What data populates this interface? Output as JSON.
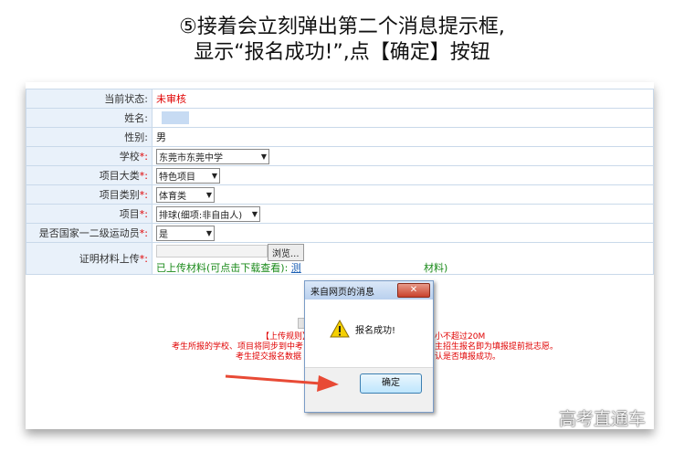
{
  "caption": {
    "line1": "⑤接着会立刻弹出第二个消息提示框,",
    "line2": "显示“报名成功!”,点【确定】按钮"
  },
  "form": {
    "rows": [
      {
        "label": "当前状态:",
        "value": "未审核"
      },
      {
        "label": "姓名:",
        "value": ""
      },
      {
        "label": "性别:",
        "value": "男"
      },
      {
        "label": "学校",
        "value": "东莞市东莞中学"
      },
      {
        "label": "项目大类",
        "value": "特色项目"
      },
      {
        "label": "项目类别",
        "value": "体育类"
      },
      {
        "label": "项目",
        "value": "排球(细项:非自由人)"
      },
      {
        "label": "是否国家一二级运动员",
        "value": "是"
      },
      {
        "label": "证明材料上传",
        "browse": "浏览...",
        "uploaded": "已上传材料(可点击下载查看):",
        "link_partial": "测",
        "tail_partial": "材料)"
      }
    ],
    "required_mark": "*:"
  },
  "rules": {
    "title_partial": "【上传规则】",
    "line1_partial": "考生所报的学校、项目将同步到中考",
    "line1_right": "主招生报名即为填报提前批志愿。",
    "line2_partial": "考生提交报名数据",
    "line2_right": "认是否填报成功。",
    "size_right": "小不超过20M"
  },
  "dialog": {
    "title": "来自网页的消息",
    "close": "✕",
    "message": "报名成功!",
    "ok": "确定"
  },
  "watermark": "高考直通车",
  "colors": {
    "required": "#e00000",
    "uploaded": "#1a8a1a",
    "arrow": "#e84a35"
  }
}
